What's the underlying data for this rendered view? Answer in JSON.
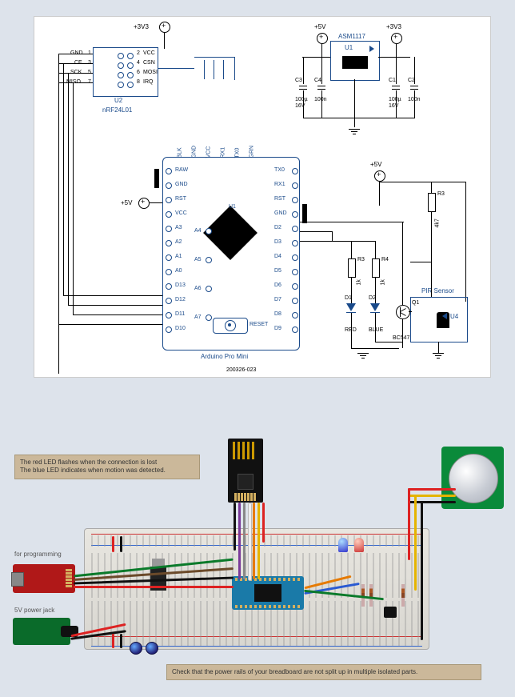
{
  "schematic": {
    "power_rails": {
      "v3v3": "+3V3",
      "v5": "+5V"
    },
    "regulator": {
      "ref": "U1",
      "part": "ASM1117"
    },
    "reg_caps": {
      "c3": {
        "ref": "C3",
        "value": "100µ",
        "voltage": "16V"
      },
      "c4": {
        "ref": "C4",
        "value": "100n"
      },
      "c1": {
        "ref": "C1",
        "value": "100µ",
        "voltage": "16V"
      },
      "c2": {
        "ref": "C2",
        "value": "100n"
      }
    },
    "nrf": {
      "ref": "U2",
      "part": "nRF24L01",
      "pins": {
        "p1": "GND",
        "p2": "VCC",
        "p3": "CE",
        "p4": "CSN",
        "p5": "SCK",
        "p6": "MOSI",
        "p7": "MISO",
        "p8": "IRQ"
      },
      "pin_nums": {
        "n1": "1",
        "n2": "2",
        "n3": "3",
        "n4": "4",
        "n5": "5",
        "n6": "6",
        "n7": "7",
        "n8": "8"
      }
    },
    "arduino": {
      "ref": "U1",
      "title": "Arduino Pro Mini",
      "reset_label": "RESET",
      "top_pins": [
        "BLK",
        "GND",
        "VCC",
        "RX1",
        "TX0",
        "GRN"
      ],
      "left_pins": [
        "RAW",
        "GND",
        "RST",
        "VCC",
        "A3",
        "A2",
        "A1",
        "A0",
        "D13",
        "D12",
        "D11",
        "D10"
      ],
      "left_alt": {
        "a4": "A4",
        "a5": "A5",
        "a6": "A6",
        "a7": "A7"
      },
      "right_pins": [
        "TX0",
        "RX1",
        "RST",
        "GND",
        "D2",
        "D3",
        "D4",
        "D5",
        "D6",
        "D7",
        "D8",
        "D9"
      ]
    },
    "leds": {
      "r3": {
        "ref": "R3",
        "value": "1k"
      },
      "r4": {
        "ref": "R4",
        "value": "1k"
      },
      "d1": {
        "ref": "D1",
        "color": "RED"
      },
      "d2": {
        "ref": "D2",
        "color": "BLUE"
      }
    },
    "pir": {
      "ref": "U4",
      "title": "PIR Sensor",
      "transistor": {
        "ref": "Q1",
        "part": "BC547"
      },
      "pullup": {
        "ref": "R3",
        "value": "4k7"
      }
    },
    "drawing_no": "200326-023"
  },
  "photo": {
    "callout_leds": "The red LED flashes when the connection is lost\nThe blue LED indicates when motion was detected.",
    "callout_rails": "Check that the power rails of your breadboard are not split up in multiple isolated parts.",
    "label_programming": "for programming",
    "label_powerjack": "5V power jack"
  }
}
